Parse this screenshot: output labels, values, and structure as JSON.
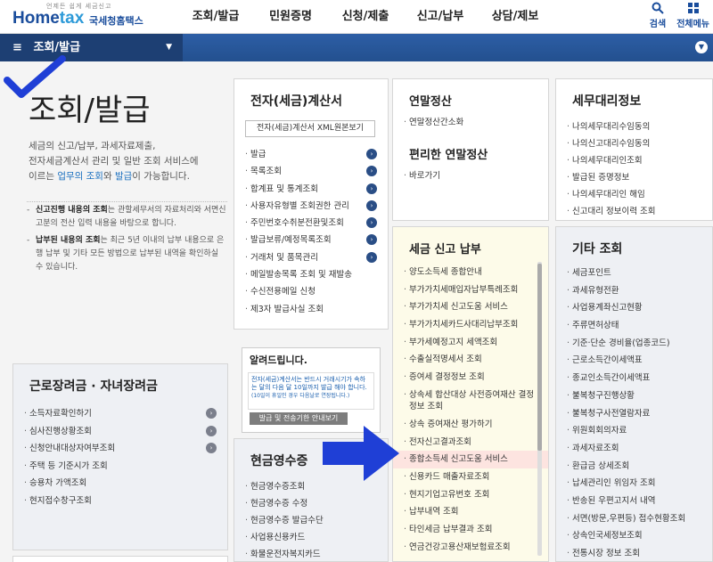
{
  "header": {
    "logo_tagline": "언제든 쉽게 세금신고",
    "logo_brand_pre": "Home",
    "logo_brand_post": "tax",
    "logo_kr": "국세청홈택스",
    "menu": [
      "조회/발급",
      "민원증명",
      "신청/제출",
      "신고/납부",
      "상담/제보"
    ],
    "search_label": "검색",
    "all_menu_label": "전체메뉴"
  },
  "navbar": {
    "current": "조회/발급"
  },
  "intro": {
    "title": "조회/발급",
    "desc_1": "세금의 신고/납부, 과세자료제출,",
    "desc_2": "전자세금계산서 관리 및 일반 조회 서비스에",
    "desc_3a": "이르는 ",
    "desc_3b": "업무의 조회",
    "desc_3c": "와 ",
    "desc_3d": "발급",
    "desc_3e": "이 가능합니다.",
    "note1_b": "신고진행 내용의 조회",
    "note1": "는 관할세무서의 자료처리와 서면신고분의 전산 입력 내용을 바탕으로 합니다.",
    "note2_b": "납부된 내용의 조회",
    "note2": "는 최근 5년 이내의 납부 내용으로 은행 납부 및 기타 모든 방법으로 납부된 내역을 확인하실 수 있습니다."
  },
  "einvoice": {
    "title": "전자(세금)계산서",
    "xml_button": "전자(세금)계산서 XML원본보기",
    "items": [
      "발급",
      "목록조회",
      "합계표 및 통계조회",
      "사용자유형별 조회권한 관리",
      "주민번호수취분전환및조회",
      "발급보류/예정목록조회",
      "거래처 및 품목관리",
      "메일발송목록 조회 및 재발송",
      "수신전용메일 신청",
      "제3자 발급사실 조회"
    ]
  },
  "notice": {
    "title": "알려드립니다.",
    "text": "전자(세금)계산서는 반드시 거래시기가 속하는 달의 다음 달 10일까지 발급 해야 합니다.",
    "small": "(10일이 휴일인 경우 다음날로 연장됩니다.)",
    "button": "발급 및 전송기한 안내보기"
  },
  "cash": {
    "title": "현금영수증",
    "items": [
      "현금영수증조회",
      "현금영수증 수정",
      "현금영수증 발급수단",
      "사업용신용카드",
      "화물운전자복지카드"
    ]
  },
  "yearend": {
    "title": "연말정산",
    "items": [
      "연말정산간소화"
    ],
    "title2": "편리한 연말정산",
    "items2": [
      "바로가기"
    ]
  },
  "taxreport": {
    "title": "세금 신고 납부",
    "items": [
      "양도소득세 종합안내",
      "부가가치세매입자납부특례조회",
      "부가가치세 신고도움 서비스",
      "부가가치세카드사대리납부조회",
      "부가세예정고지 세액조회",
      "수출실적명세서 조회",
      "증여세 결정정보 조회",
      "상속세 합산대상 사전증여재산 결정정보 조회",
      "상속 증여재산 평가하기",
      "전자신고결과조회",
      "종합소득세 신고도움 서비스",
      "신용카드 매출자료조회",
      "현지기업고유번호 조회",
      "납부내역 조회",
      "타인세금 납부결과 조회",
      "연금건강고용산재보험료조회"
    ]
  },
  "agent": {
    "title": "세무대리정보",
    "items": [
      "나의세무대리수임동의",
      "나의신고대리수임동의",
      "나의세무대리인조회",
      "발급된 증명정보",
      "나의세무대리인 해임",
      "신고대리 정보이력 조회"
    ]
  },
  "etc": {
    "title": "기타 조회",
    "items": [
      "세금포인트",
      "과세유형전환",
      "사업용계좌신고현황",
      "주류면허상태",
      "기준·단순 경비율(업종코드)",
      "근로소득간이세액표",
      "종교인소득간이세액표",
      "불복청구진행상황",
      "불복청구사전열람자료",
      "위원회회의자료",
      "과세자료조회",
      "환급금 상세조회",
      "납세관리인 위임자 조회",
      "반송된 우편고지서 내역",
      "서면(방문,우편등) 접수현황조회",
      "상속인국세정보조회",
      "전통시장 정보 조회"
    ]
  },
  "work": {
    "title": "근로장려금 · 자녀장려금",
    "items": [
      "소득자료확인하기",
      "심사진행상황조회",
      "신청안내대상자여부조회",
      "주택 등 기준시가 조회",
      "승용차 가액조회",
      "현지접수창구조회"
    ]
  },
  "colors": {
    "brand": "#1a4d9c",
    "navbar": "#2d5ea5",
    "highlight": "#fde4e0",
    "arrow": "#1f3fd6"
  }
}
